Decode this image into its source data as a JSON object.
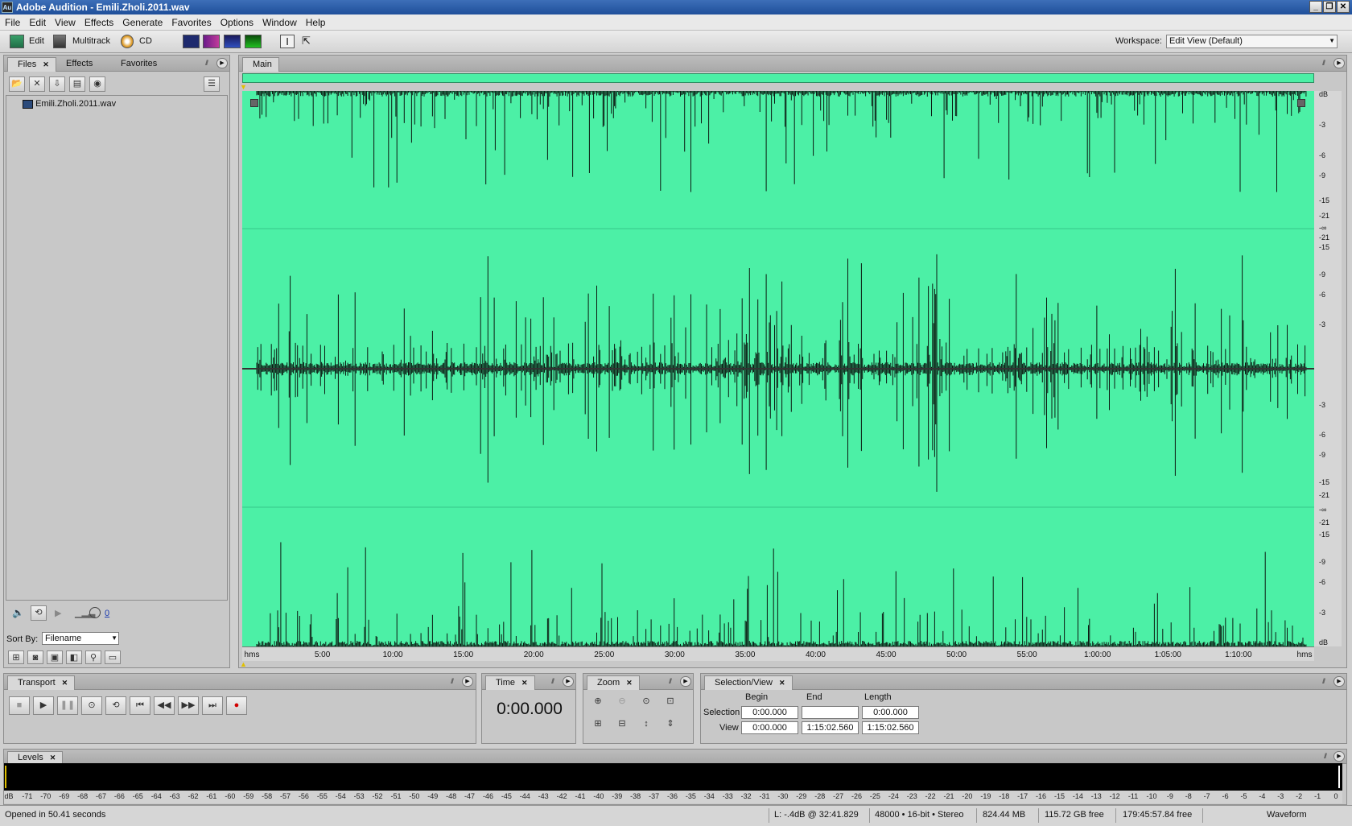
{
  "window": {
    "title": "Adobe Audition - Emili.Zholi.2011.wav",
    "app_icon": "Au"
  },
  "menu": [
    "File",
    "Edit",
    "View",
    "Effects",
    "Generate",
    "Favorites",
    "Options",
    "Window",
    "Help"
  ],
  "toolbar": {
    "edit_label": "Edit",
    "multitrack_label": "Multitrack",
    "cd_label": "CD",
    "workspace_label": "Workspace:",
    "workspace_value": "Edit View (Default)"
  },
  "files_panel": {
    "tabs": [
      "Files",
      "Effects",
      "Favorites"
    ],
    "files": [
      "Emili.Zholi.2011.wav"
    ],
    "sort_label": "Sort By:",
    "sort_value": "Filename",
    "volume_value": "0"
  },
  "editor": {
    "tab": "Main",
    "accent_color": "#4cf0a6",
    "ruler_ticks": [
      "hms",
      "5:00",
      "10:00",
      "15:00",
      "20:00",
      "25:00",
      "30:00",
      "35:00",
      "40:00",
      "45:00",
      "50:00",
      "55:00",
      "1:00:00",
      "1:05:00",
      "1:10:00",
      "hms"
    ],
    "db_labels_left_channel": [
      "dB",
      "-3",
      "-6",
      "-9",
      "-15",
      "-21",
      "-∞",
      "-21",
      "-15",
      "-9",
      "-6",
      "-3"
    ],
    "db_labels_right_channel": [
      "-3",
      "-6",
      "-9",
      "-15",
      "-21",
      "-∞",
      "-21",
      "-15",
      "-9",
      "-6",
      "-3",
      "dB"
    ]
  },
  "transport": {
    "tab": "Transport"
  },
  "time": {
    "tab": "Time",
    "value": "0:00.000"
  },
  "zoom": {
    "tab": "Zoom"
  },
  "selection_view": {
    "tab": "Selection/View",
    "headers": [
      "Begin",
      "End",
      "Length"
    ],
    "selection_label": "Selection",
    "view_label": "View",
    "selection": {
      "begin": "0:00.000",
      "end": "",
      "length": "0:00.000"
    },
    "view": {
      "begin": "0:00.000",
      "end": "1:15:02.560",
      "length": "1:15:02.560"
    }
  },
  "levels": {
    "tab": "Levels",
    "scale": [
      "dB",
      "-71",
      "-70",
      "-69",
      "-68",
      "-67",
      "-66",
      "-65",
      "-64",
      "-63",
      "-62",
      "-61",
      "-60",
      "-59",
      "-58",
      "-57",
      "-56",
      "-55",
      "-54",
      "-53",
      "-52",
      "-51",
      "-50",
      "-49",
      "-48",
      "-47",
      "-46",
      "-45",
      "-44",
      "-43",
      "-42",
      "-41",
      "-40",
      "-39",
      "-38",
      "-37",
      "-36",
      "-35",
      "-34",
      "-33",
      "-32",
      "-31",
      "-30",
      "-29",
      "-28",
      "-27",
      "-26",
      "-25",
      "-24",
      "-23",
      "-22",
      "-21",
      "-20",
      "-19",
      "-18",
      "-17",
      "-16",
      "-15",
      "-14",
      "-13",
      "-12",
      "-11",
      "-10",
      "-9",
      "-8",
      "-7",
      "-6",
      "-5",
      "-4",
      "-3",
      "-2",
      "-1",
      "0"
    ]
  },
  "status": {
    "message": "Opened in 50.41 seconds",
    "cursor": "L: -.4dB @  32:41.829",
    "format": "48000 • 16-bit • Stereo",
    "size": "824.44 MB",
    "disk_free": "115.72 GB free",
    "time_free": "179:45:57.84 free",
    "view": "Waveform"
  }
}
